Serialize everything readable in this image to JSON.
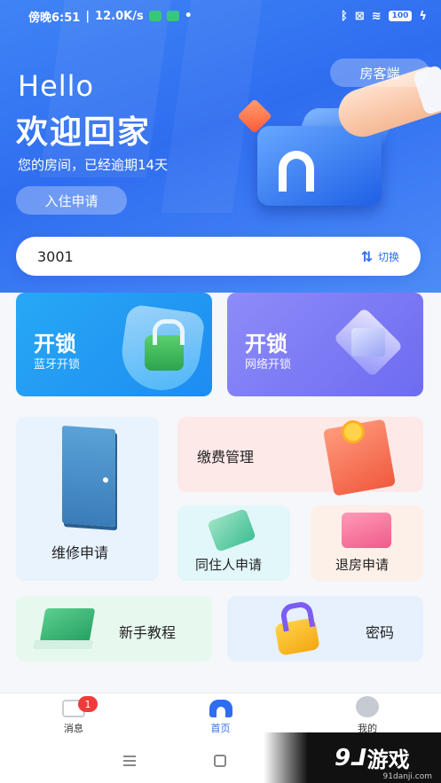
{
  "status_bar": {
    "time": "傍晚6:51",
    "speed": "12.0K/s",
    "battery": "100"
  },
  "header": {
    "role_switch_label": "房客端",
    "greeting": "Hello",
    "welcome": "欢迎回家",
    "overdue_notice": "您的房间，已经逾期14天",
    "checkin_label": "入住申请"
  },
  "room_selector": {
    "room_number": "3001",
    "switch_label": "切换"
  },
  "unlock_cards": [
    {
      "title": "开锁",
      "subtitle": "蓝牙开锁"
    },
    {
      "title": "开锁",
      "subtitle": "网络开锁"
    }
  ],
  "services": {
    "repair": "维修申请",
    "payment": "缴费管理",
    "cohabitant": "同住人申请",
    "checkout": "退房申请",
    "guide": "新手教程",
    "password": "密码"
  },
  "tabbar": {
    "tabs": [
      {
        "label": "消息",
        "badge": "1"
      },
      {
        "label": "首页"
      },
      {
        "label": "我的"
      }
    ],
    "active_color": "#2f6df0"
  },
  "watermark": {
    "logo": "9⅃",
    "text": "游戏",
    "url": "91danji.com"
  },
  "colors": {
    "primary": "#2f6df0",
    "bluetooth_card": "#1e8cf2",
    "network_card": "#6d6bf1",
    "badge": "#f03b3b"
  }
}
